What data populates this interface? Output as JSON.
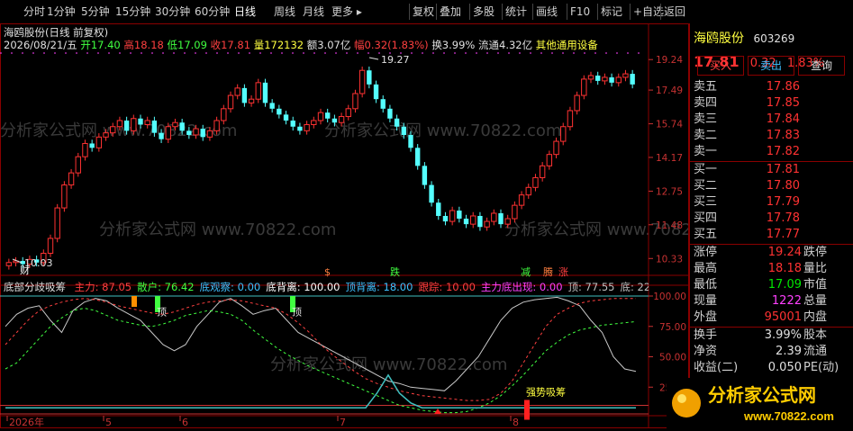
{
  "toolbar": {
    "left_items": [
      "分时",
      "1分钟",
      "5分钟",
      "15分钟",
      "30分钟",
      "60分钟",
      "日线",
      "周线",
      "月线",
      "更多 ▸"
    ],
    "right_items": [
      "复权",
      "叠加",
      "多股",
      "统计",
      "画线",
      "F10",
      "标记",
      "+自选",
      "返回"
    ],
    "active": "日线"
  },
  "stock": {
    "name": "海鸥股份",
    "code": "603269",
    "price": "17.81",
    "change": "0.32",
    "change_pct": "1.83%",
    "buttons": [
      "买入",
      "卖出",
      "查询"
    ]
  },
  "kline_header": {
    "title": "海鸥股份(日线 前复权)",
    "date": "2026/08/21/五",
    "open": "开17.40",
    "high": "高18.18",
    "low": "低17.09",
    "close": "收17.81",
    "volume": "量172132",
    "amount": "额3.07亿",
    "amplitude": "幅0.32(1.83%)",
    "turnover": "换3.99%",
    "float": "流通4.32亿",
    "sector": "其他通用设备"
  },
  "price_axis": [
    "19.24",
    "17.49",
    "15.74",
    "14.17",
    "12.75",
    "11.48",
    "10.33"
  ],
  "annotations": {
    "high_marker": "19.27",
    "low_marker": "10.03",
    "cai": "财",
    "dollar": "$",
    "die": "跌",
    "jian": "减",
    "teng": "腾",
    "zhang": "涨"
  },
  "indicator_header": {
    "name": "底部分歧吸筹",
    "items": [
      {
        "label": "主力: 87.05",
        "color": "#ff4040"
      },
      {
        "label": "散户: 76.42",
        "color": "#40ff40"
      },
      {
        "label": "底观察: 0.00",
        "color": "#40c0ff"
      },
      {
        "label": "底背离: 100.00",
        "color": "#ffffff"
      },
      {
        "label": "顶背离: 18.00",
        "color": "#40c0ff"
      },
      {
        "label": "跟踪: 10.00",
        "color": "#ff4040"
      },
      {
        "label": "主力底出现: 0.00",
        "color": "#ff40ff"
      },
      {
        "label": "顶: 77.55",
        "color": "#c0c0c0"
      },
      {
        "label": "底: 22.4",
        "color": "#c0c0c0"
      }
    ]
  },
  "indicator_axis": [
    "100.00",
    "75.00",
    "50.00",
    "25.00"
  ],
  "indicator_labels": {
    "ding1": "顶",
    "ding2": "顶",
    "strong": "强势吸筹"
  },
  "x_axis": [
    "2026年",
    "5",
    "6",
    "7",
    "8"
  ],
  "quote": {
    "sell": [
      {
        "label": "卖五",
        "price": "17.86"
      },
      {
        "label": "卖四",
        "price": "17.85"
      },
      {
        "label": "卖三",
        "price": "17.84"
      },
      {
        "label": "卖二",
        "price": "17.83"
      },
      {
        "label": "卖一",
        "price": "17.82"
      }
    ],
    "buy": [
      {
        "label": "买一",
        "price": "17.81"
      },
      {
        "label": "买二",
        "price": "17.80"
      },
      {
        "label": "买三",
        "price": "17.79"
      },
      {
        "label": "买四",
        "price": "17.78"
      },
      {
        "label": "买五",
        "price": "17.77"
      }
    ],
    "stats": [
      {
        "label": "涨停",
        "value": "19.24",
        "label2": "跌停",
        "vcolor": "#ff3232"
      },
      {
        "label": "最高",
        "value": "18.18",
        "label2": "量比",
        "vcolor": "#ff3232"
      },
      {
        "label": "最低",
        "value": "17.09",
        "label2": "市值",
        "vcolor": "#00e600"
      },
      {
        "label": "现量",
        "value": "1222",
        "label2": "总量",
        "vcolor": "#ff40ff"
      },
      {
        "label": "外盘",
        "value": "95001",
        "label2": "内盘",
        "vcolor": "#ff3232"
      }
    ],
    "stats2": [
      {
        "label": "换手",
        "value": "3.99%",
        "label2": "股本"
      },
      {
        "label": "净资",
        "value": "2.39",
        "label2": "流通"
      },
      {
        "label": "收益(二)",
        "value": "0.050",
        "label2": "PE(动)"
      }
    ]
  },
  "watermark": {
    "text": "分析家公式网",
    "url": "www.70822.com",
    "wm_repeat": "分析家公式网 www.70822.com"
  },
  "colors": {
    "up": "#ff3232",
    "down": "#54ffff",
    "frame": "#8a0000",
    "accent": "#ff3232"
  }
}
